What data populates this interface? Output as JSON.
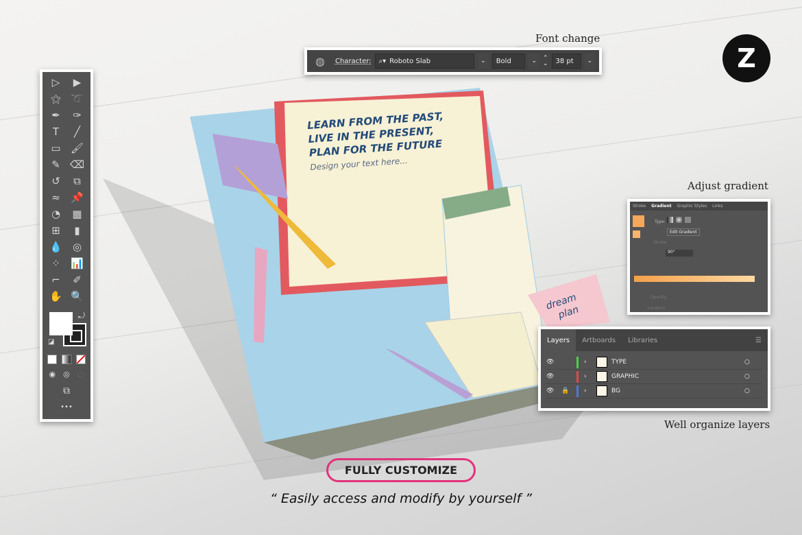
{
  "labels": {
    "font_change": "Font change",
    "adjust_gradient": "Adjust gradient",
    "well_organize": "Well organize layers"
  },
  "character_bar": {
    "label": "Character:",
    "font": "Roboto Slab",
    "style": "Bold",
    "size": "38 pt"
  },
  "gradient_panel": {
    "tabs": [
      "Stroke",
      "Gradient",
      "Graphic Styles",
      "Links"
    ],
    "type_label": "Type:",
    "edit_button": "Edit Gradient",
    "stroke_label": "Stroke",
    "angle": "90°",
    "opacity_label": "Opacity",
    "location_label": "Location",
    "start_color": "#f5a04a",
    "end_color": "#fcd9a2"
  },
  "layers_panel": {
    "tabs": [
      "Layers",
      "Artboards",
      "Libraries"
    ],
    "layers": [
      {
        "name": "TYPE",
        "color": "#4bd04b",
        "locked": false
      },
      {
        "name": "GRAPHIC",
        "color": "#e04848",
        "locked": false
      },
      {
        "name": "BG",
        "color": "#4a78e0",
        "locked": true
      }
    ]
  },
  "book": {
    "line1": "LEARN FROM THE PAST,",
    "line2": "LIVE IN THE PRESENT,",
    "line3": "PLAN FOR THE FUTURE",
    "subtitle": "Design your text here...",
    "note1": "dream",
    "note2": "plan"
  },
  "badge": "FULLY CUSTOMIZE",
  "tagline": "“ Easily access and modify by yourself ”",
  "toolbar": {
    "tools": [
      "selection",
      "direct-selection",
      "magic-wand",
      "lasso",
      "pen",
      "curvature",
      "type",
      "line",
      "rectangle",
      "paintbrush",
      "shaper",
      "eraser",
      "rotate",
      "scale",
      "warp",
      "puppet-warp",
      "shape-builder",
      "perspective-grid",
      "mesh",
      "gradient",
      "eyedropper",
      "blend",
      "symbol-sprayer",
      "column-graph",
      "artboard",
      "slice",
      "hand",
      "zoom"
    ],
    "more": "•••"
  },
  "colors": {
    "accent": "#e2317a",
    "panel": "#535353"
  }
}
